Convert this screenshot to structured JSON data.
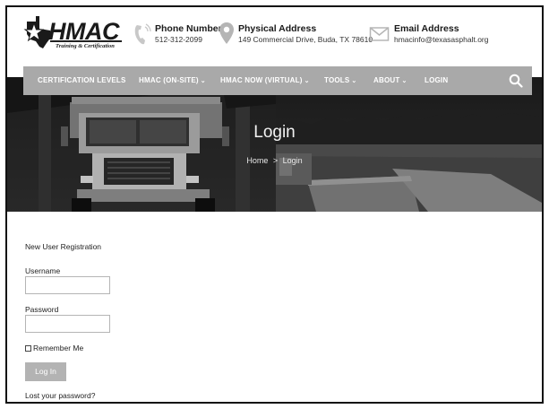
{
  "brand": {
    "name": "HMAC",
    "tagline": "Training & Certification"
  },
  "contact": {
    "phone": {
      "title": "Phone Number",
      "value": "512-312-2099",
      "icon": "phone-icon"
    },
    "address": {
      "title": "Physical Address",
      "value": "149 Commercial Drive, Buda, TX 78610",
      "icon": "map-pin-icon"
    },
    "email": {
      "title": "Email Address",
      "value": "hmacinfo@texasasphalt.org",
      "icon": "envelope-icon"
    }
  },
  "nav": {
    "items": [
      {
        "label": "CERTIFICATION LEVELS",
        "has_dropdown": false
      },
      {
        "label": "HMAC (ON-SITE)",
        "has_dropdown": true
      },
      {
        "label": "HMAC NOW (VIRTUAL)",
        "has_dropdown": true
      },
      {
        "label": "TOOLS",
        "has_dropdown": true
      },
      {
        "label": "ABOUT",
        "has_dropdown": true
      },
      {
        "label": "LOGIN",
        "has_dropdown": false
      }
    ],
    "chevron": "⌄",
    "search_icon": "search-icon",
    "bg_color": "#a9a9a9"
  },
  "hero": {
    "title": "Login",
    "breadcrumb": {
      "home": "Home",
      "separator": ">",
      "current": "Login"
    }
  },
  "form": {
    "register_link": "New User Registration",
    "username_label": "Username",
    "username_value": "",
    "password_label": "Password",
    "password_value": "",
    "remember_label": "Remember Me",
    "submit_label": "Log In",
    "lost_password_link": "Lost your password?"
  }
}
